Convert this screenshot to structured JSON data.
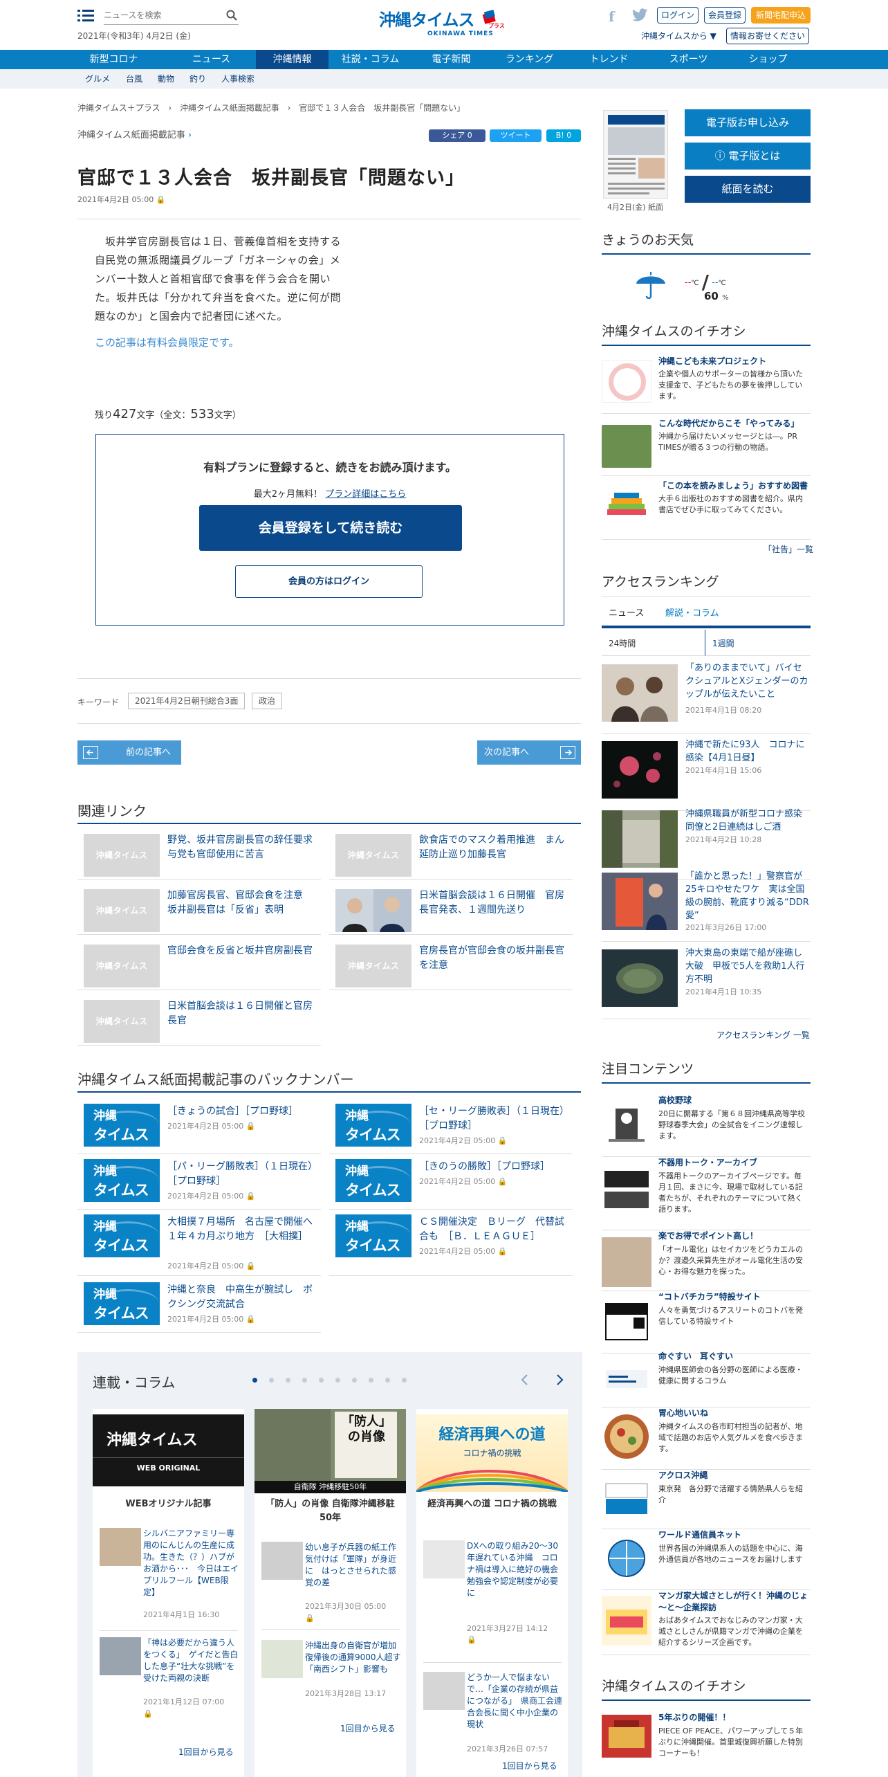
{
  "header": {
    "search_placeholder": "ニュースを検索",
    "date": "2021年(令和3年) 4月2日 (金)",
    "logo_jp": "沖縄タイムス",
    "logo_en": "OKINAWA TIMES",
    "logo_plus": "プラス",
    "login": "ログイン",
    "register": "会員登録",
    "delivery": "新聞宅配申込",
    "from_okinawa": "沖縄タイムスから ▼",
    "info_submit": "情報お寄せください"
  },
  "nav": [
    "新型コロナ",
    "ニュース",
    "沖縄情報",
    "社説・コラム",
    "電子新聞",
    "ランキング",
    "トレンド",
    "スポーツ",
    "ショップ"
  ],
  "subnav": [
    "グルメ",
    "台風",
    "動物",
    "釣り",
    "人事検索"
  ],
  "breadcrumb": [
    "沖縄タイムス＋プラス",
    "›",
    "沖縄タイムス紙面掲載記事",
    "›",
    "官邸で１３人会合　坂井副長官「問題ない」"
  ],
  "article": {
    "section": "沖縄タイムス紙面掲載記事",
    "share_fb": "シェア 0",
    "share_tw": "ツイート",
    "share_hb": "B! 0",
    "title": "官邸で１３人会合　坂井副長官「問題ない」",
    "date": "2021年4月2日 05:00",
    "body": "坂井学官房副長官は１日、菅義偉首相を支持する自民党の無派閥議員グループ「ガネーシャの会」メンバー十数人と首相官邸で食事を伴う会合を開いた。坂井氏は「分かれて弁当を食べた。逆に何が問題なのか」と国会内で記者団に述べた。",
    "paid_note": "この記事は有料会員限定です。",
    "remain_prefix": "残り",
    "remain_count": "427",
    "remain_mid": "文字（全文：",
    "total_count": "533",
    "remain_suffix": "文字）"
  },
  "paywall": {
    "heading": "有料プランに登録すると、続きをお読み頂けます。",
    "free": "最大2ヶ月無料！",
    "plan_link": "プラン詳細はこちら",
    "register_button": "会員登録をして続き読む",
    "login_button": "会員の方はログイン"
  },
  "keywords": {
    "label": "キーワード",
    "items": [
      "2021年4月2日朝刊総合3面",
      "政治"
    ]
  },
  "prev": "前の記事へ",
  "next": "次の記事へ",
  "related": {
    "heading": "関連リンク",
    "thumb_text": "沖縄タイムス",
    "items": [
      "野党、坂井官房副長官の辞任要求　与党も官邸使用に苦言",
      "飲食店でのマスク着用推進　まん延防止巡り加藤長官",
      "加藤官房長官、官邸会食を注意　坂井副長官は「反省」表明",
      "日米首脳会談は１６日開催　官房長官発表、１週間先送り",
      "官邸会食を反省と坂井官房副長官",
      "官房長官が官邸会食の坂井副長官を注意",
      "日米首脳会談は１６日開催と官房長官"
    ]
  },
  "backnumber": {
    "heading": "沖縄タイムス紙面掲載記事のバックナンバー",
    "logo_a": "沖縄",
    "logo_b": "タイムス",
    "items": [
      {
        "title": "［きょうの試合］［プロ野球］",
        "date": "2021年4月2日 05:00"
      },
      {
        "title": "［セ・リーグ勝敗表］（１日現在）　［プロ野球］",
        "date": "2021年4月2日 05:00"
      },
      {
        "title": "［パ・リーグ勝敗表］（１日現在）　［プロ野球］",
        "date": "2021年4月2日 05:00"
      },
      {
        "title": "［きのうの勝敗］［プロ野球］",
        "date": "2021年4月2日 05:00"
      },
      {
        "title": "大相撲７月場所　名古屋で開催へ　１年４カ月ぶり地方　［大相撲］",
        "date": "2021年4月2日 05:00"
      },
      {
        "title": "ＣＳ開催決定　Ｂリーグ　代替試合も　［Ｂ．ＬＥＡＧＵＥ］",
        "date": "2021年4月2日 05:00"
      },
      {
        "title": "沖縄と奈良　中高生が腕試し　ボクシング交流試合",
        "date": "2021年4月2日 05:00"
      }
    ]
  },
  "rensai": {
    "heading": "連載・コラム",
    "cols": [
      {
        "banner_title": "沖縄タイムス",
        "banner_sub": "WEB ORIGINAL",
        "title": "WEBオリジナル記事",
        "articles": [
          {
            "title": "シルバニアファミリー専用のにんじんの生産に成功。生きた（？）ハブがお酒から･･･　今日はエイプリルフール【WEB限定】",
            "date": "2021年4月1日 16:30"
          },
          {
            "title": "「神は必要だから違う人をつくる」　ゲイだと告白した息子“壮大な挑戦”を受けた両親の決断",
            "date": "2021年1月12日 07:00"
          }
        ],
        "more": "1回目から見る"
      },
      {
        "banner_title": "「防人」の肖像",
        "banner_sub": "自衛隊 沖縄移駐50年",
        "title": "「防人」の肖像 自衛隊沖縄移駐50年",
        "articles": [
          {
            "title": "幼い息子が兵器の紙工作　気付けば「軍隊」が身近に　はっとさせられた感覚の差",
            "date": "2021年3月30日 05:00"
          },
          {
            "title": "沖縄出身の自衛官が増加　復帰後の通算9000人超す　「南西シフト」影響も",
            "date": "2021年3月28日 13:17"
          }
        ],
        "more": "1回目から見る"
      },
      {
        "banner_title": "経済再興への道",
        "banner_sub": "コロナ禍の挑戦",
        "title": "経済再興への道 コロナ禍の挑戦",
        "articles": [
          {
            "title": "DXへの取り組み20～30年遅れている沖縄　コロナ禍は導入に絶好の機会　勉強会や認定制度が必要に",
            "date": "2021年3月27日 14:12"
          },
          {
            "title": "どうか一人で悩まないで…「企業の存続が県益につながる」　県商工会連合会長に聞く中小企業の現状",
            "date": "2021年3月26日 07:57"
          }
        ],
        "more": "1回目から見る"
      }
    ]
  },
  "sidebar": {
    "paper_date": "4月2日(金) 紙面",
    "btn_apply": "電子版お申し込み",
    "btn_about": "電子版とは",
    "btn_read": "紙面を読む",
    "weather": {
      "heading": "きょうのお天気",
      "hi": "--",
      "lo": "--",
      "unit": "℃",
      "slash": "/",
      "rain": "60",
      "rain_unit": "%"
    },
    "pick": {
      "heading": "沖縄タイムスのイチオシ",
      "items": [
        {
          "title": "沖縄こども未来プロジェクト",
          "desc": "企業や個人のサポーターの皆様から頂いた支援金で、子どもたちの夢を後押ししています。"
        },
        {
          "title": "こんな時代だからこそ「やってみる」",
          "desc": "沖縄から届けたいメッセージとは―。PR TIMESが贈る３つの行動の物語。"
        },
        {
          "title": "「この本を読みましょう」おすすめ図書",
          "desc": "大手６出版社のおすすめ図書を紹介。県内書店でぜひ手に取ってみてください。"
        }
      ],
      "more": "「社告」一覧"
    },
    "ranking": {
      "heading": "アクセスランキング",
      "tabs": [
        "ニュース",
        "解説・コラム"
      ],
      "periods": [
        "24時間",
        "1週間"
      ],
      "items": [
        {
          "title": "「ありのままでいて」バイセクシュアルとXジェンダーのカップルが伝えたいこと",
          "date": "2021年4月1日 08:20"
        },
        {
          "title": "沖縄で新たに93人　コロナに感染【4月1日昼】",
          "date": "2021年4月1日 15:06"
        },
        {
          "title": "沖縄県職員が新型コロナ感染　同僚と2日連続はしご酒",
          "date": "2021年4月2日 10:28"
        },
        {
          "title": "「誰かと思った！」警察官が25キロやせたワケ　実は全国級の腕前、靴底すり減る“DDR愛”",
          "date": "2021年3月26日 17:00"
        },
        {
          "title": "沖大東島の東端で船が座礁し大破　甲板で5人を救助1人行方不明",
          "date": "2021年4月1日 10:35"
        }
      ],
      "more": "アクセスランキング 一覧"
    },
    "notable": {
      "heading": "注目コンテンツ",
      "items": [
        {
          "title": "高校野球",
          "desc": "20日に開幕する「第６８回沖縄県高等学校野球春季大会」の全試合をイニング速報します。"
        },
        {
          "title": "不器用トーク・アーカイブ",
          "desc": "不器用トークのアーカイブページです。毎月１回、まさに今、現場で取材している記者たちが、それぞれのテーマについて熱く語ります。"
        },
        {
          "title": "楽でお得でポイント高し！",
          "desc": "「オール電化」はセイカツをどうカエルのか？渡邉久采算先生がオール電化生活の安心・お得な魅力を探った。"
        },
        {
          "title": "“コトバチカラ”特設サイト",
          "desc": "人々を勇気づけるアスリートのコトバを発信している特設サイト"
        },
        {
          "title": "命ぐすい　耳ぐすい",
          "desc": "沖縄県医師会の各分野の医師による医療・健康に関するコラム"
        },
        {
          "title": "胃心地いいね",
          "desc": "沖縄タイムスの各市町村担当の記者が、地域で話題のお店や人気グルメを食べ歩きます。"
        },
        {
          "title": "アクロス沖縄",
          "desc": "東京発　各分野で活躍する情熱県人らを紹介"
        },
        {
          "title": "ワールド通信員ネット",
          "desc": "世界各国の沖縄県系人の話題を中心に、海外通信員が各地のニュースをお届けします"
        },
        {
          "title": "マンガ家大城さとしが行く！沖縄のじょ～と～企業探訪",
          "desc": "おばあタイムスでおなじみのマンガ家・大城さとしさんが県籍マンガで沖縄の企業を紹介するシリーズ企画です。"
        }
      ]
    },
    "pick2": {
      "heading": "沖縄タイムスのイチオシ",
      "items": [
        {
          "title": "5年ぶりの開催！！",
          "desc": "PIECE OF PEACE、パワーアップして５年ぶりに沖縄開催。首里城復興祈願した特別コーナーも！"
        }
      ]
    }
  }
}
